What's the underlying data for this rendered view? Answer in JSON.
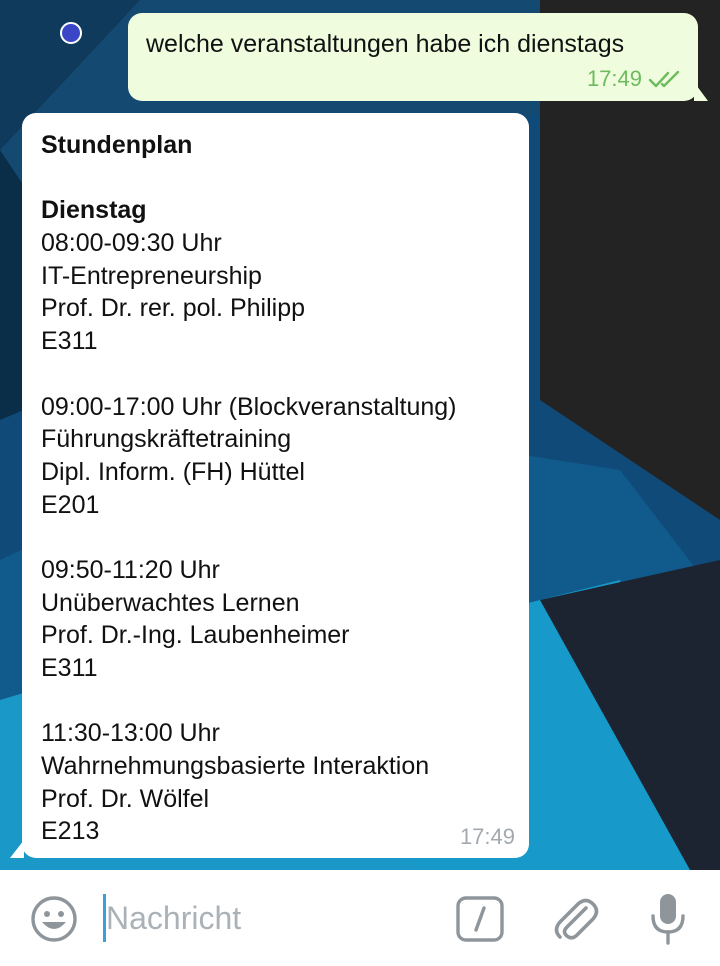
{
  "chat": {
    "outgoing": {
      "text": "welche veranstaltungen habe ich dienstags",
      "time": "17:49",
      "status_icon": "double-check-icon"
    },
    "incoming": {
      "lines": [
        "Stundenplan",
        "",
        "Dienstag",
        "08:00-09:30 Uhr",
        "IT-Entrepreneurship",
        "Prof. Dr. rer. pol. Philipp",
        "E311",
        "",
        "09:00-17:00 Uhr (Blockveranstaltung)",
        "Führungskräftetraining",
        "Dipl. Inform. (FH) Hüttel",
        "E201",
        "",
        "09:50-11:20 Uhr",
        "Unüberwachtes Lernen",
        "Prof. Dr.-Ing. Laubenheimer",
        "E311",
        "",
        "11:30-13:00 Uhr",
        "Wahrnehmungsbasierte Interaktion",
        "Prof. Dr. Wölfel",
        "E213"
      ],
      "time": "17:49"
    }
  },
  "input_bar": {
    "placeholder": "Nachricht",
    "icons": [
      "emoji-icon",
      "bot-command-icon",
      "paperclip-icon",
      "microphone-icon"
    ]
  },
  "colors": {
    "outgoing_bubble": "#effdde",
    "incoming_bubble": "#ffffff",
    "check_green": "#6dbb5e",
    "time_gray": "#a3a9ae",
    "badge_dot": "#3a46c6",
    "icon_gray": "#8e969c"
  }
}
